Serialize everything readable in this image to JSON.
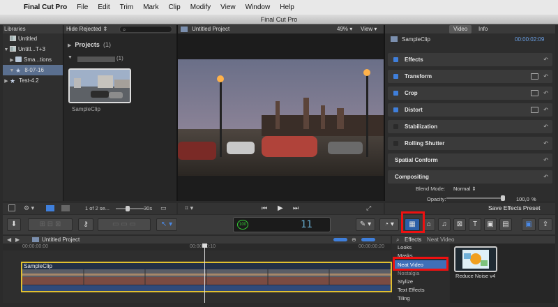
{
  "menubar": {
    "app_name": "Final Cut Pro",
    "items": [
      "File",
      "Edit",
      "Trim",
      "Mark",
      "Clip",
      "Modify",
      "View",
      "Window",
      "Help"
    ]
  },
  "window": {
    "title": "Final Cut Pro"
  },
  "libraries": {
    "header": "Libraries",
    "items": [
      {
        "label": "Untitled"
      },
      {
        "label": "Untitl...T+3"
      },
      {
        "label": "Sma...tions"
      },
      {
        "label": "8-07-16"
      },
      {
        "label": "Test-4.2"
      }
    ]
  },
  "browser": {
    "filter_label": "Hide Rejected",
    "projects_label": "Projects",
    "projects_count": "(1)",
    "event_count": "(1)",
    "clip_name": "SampleClip",
    "footer_count": "1 of 2 se...",
    "footer_duration": "30s"
  },
  "viewer": {
    "title": "Untitled Project",
    "zoom": "49%",
    "view_label": "View"
  },
  "inspector": {
    "tabs": [
      "Video",
      "Info"
    ],
    "clip_name": "SampleClip",
    "timecode": "00:00:02:09",
    "sections": [
      {
        "label": "Effects",
        "checked": true
      },
      {
        "label": "Transform",
        "checked": true
      },
      {
        "label": "Crop",
        "checked": true
      },
      {
        "label": "Distort",
        "checked": true
      },
      {
        "label": "Stabilization",
        "checked": false
      },
      {
        "label": "Rolling Shutter",
        "checked": false
      },
      {
        "label": "Spatial Conform",
        "checked": false
      },
      {
        "label": "Compositing",
        "checked": false
      }
    ],
    "blend_mode_label": "Blend Mode:",
    "blend_mode_value": "Normal",
    "opacity_label": "Opacity:",
    "opacity_value": "100,0",
    "opacity_unit": "%",
    "save_preset": "Save Effects Preset"
  },
  "timeline": {
    "project_name": "Untitled Project",
    "ruler": [
      "00:00:00:00",
      "00:00:00:10",
      "00:00:00:20"
    ],
    "clip_name": "SampleClip",
    "timecode_display": "11",
    "timecode_small": "100"
  },
  "effects": {
    "header": "Effects",
    "subheader": "Neat Video",
    "categories": [
      "Looks",
      "Masks",
      "Neat Video",
      "Nostalgia",
      "Stylize",
      "Text Effects",
      "Tiling"
    ],
    "selected_category": "Neat Video",
    "item_name": "Reduce Noise v4"
  },
  "colors": {
    "accent": "#3f7fdb",
    "highlight": "#e11111",
    "clip_border": "#e0c030"
  }
}
